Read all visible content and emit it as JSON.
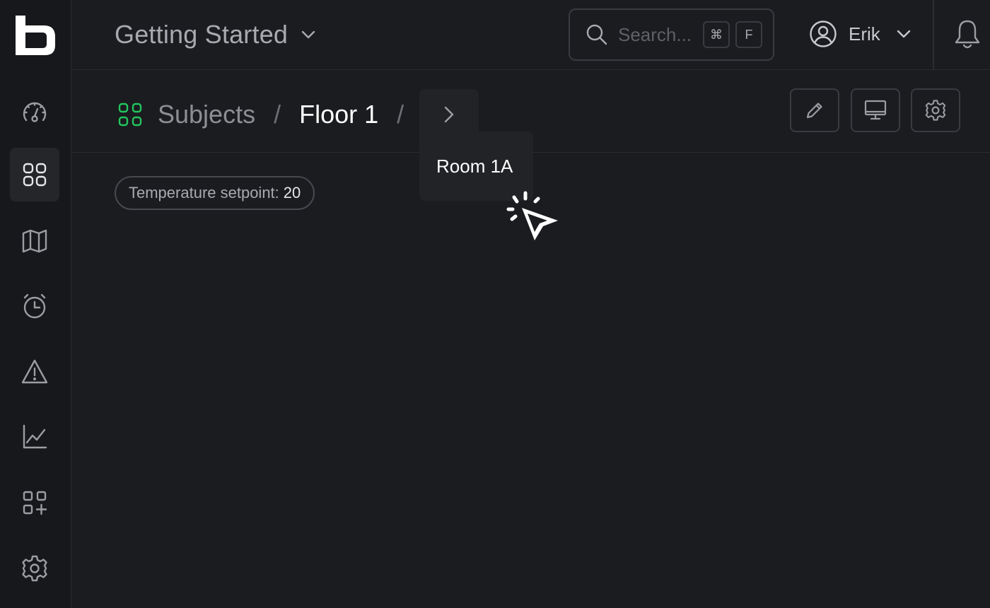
{
  "sidebar": {
    "items": [
      {
        "icon": "dashboard-gauge-icon"
      },
      {
        "icon": "subjects-grid-icon",
        "active": true
      },
      {
        "icon": "map-icon"
      },
      {
        "icon": "alarm-clock-icon"
      },
      {
        "icon": "warning-icon"
      },
      {
        "icon": "chart-line-icon"
      },
      {
        "icon": "add-widget-icon"
      },
      {
        "icon": "settings-gear-icon"
      }
    ]
  },
  "header": {
    "project_title": "Getting Started",
    "search_placeholder": "Search...",
    "search_shortcut_mod": "⌘",
    "search_shortcut_key": "F",
    "user_name": "Erik"
  },
  "breadcrumb": {
    "root": "Subjects",
    "separator": "/",
    "current": "Floor 1",
    "dropdown_items": [
      "Room 1A"
    ]
  },
  "content": {
    "property_label": "Temperature setpoint:",
    "property_value": "20"
  },
  "colors": {
    "background": "#1b1c20",
    "sidebar": "#17181b",
    "accent_green": "#22c55e",
    "border": "#3a3b40"
  }
}
